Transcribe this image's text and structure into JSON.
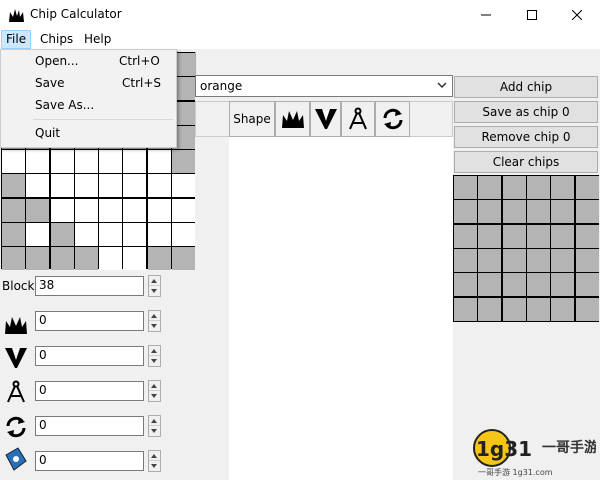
{
  "window": {
    "title": "Chip Calculator"
  },
  "menubar": {
    "items": [
      "File",
      "Chips",
      "Help"
    ]
  },
  "file_menu": {
    "items": [
      {
        "label": "Open...",
        "shortcut": "Ctrl+O"
      },
      {
        "label": "Save",
        "shortcut": "Ctrl+S"
      },
      {
        "label": "Save As...",
        "shortcut": ""
      },
      {
        "label": "Quit",
        "shortcut": ""
      }
    ]
  },
  "board": {
    "rows": [
      [
        "w",
        "w",
        "w",
        "w",
        "w",
        "w",
        "w",
        "g"
      ],
      [
        "g",
        "w",
        "w",
        "w",
        "w",
        "w",
        "w",
        "w"
      ],
      [
        "g",
        "g",
        "w",
        "w",
        "w",
        "w",
        "w",
        "w"
      ],
      [
        "g",
        "w",
        "g",
        "w",
        "w",
        "w",
        "w",
        "w"
      ],
      [
        "g",
        "g",
        "g",
        "g",
        "w",
        "w",
        "g",
        "g"
      ]
    ]
  },
  "stats": {
    "blocks_label": "Blocks",
    "blocks_value": "38",
    "damage_value": "0",
    "breach_value": "0",
    "precision_value": "0",
    "reload_value": "0",
    "extra_value": "0"
  },
  "color_select": {
    "value": "orange"
  },
  "toolbar": {
    "shape_label": "Shape"
  },
  "actions": {
    "add_chip": "Add chip",
    "save_as_chip": "Save as chip 0",
    "remove_chip": "Remove chip 0",
    "clear_chips": "Clear chips"
  },
  "chip_grid": {
    "cols": 6,
    "rows": 6
  },
  "watermark": {
    "brand": "1g31",
    "tag": "一哥手游",
    "url": "一哥手游 1g31.com"
  },
  "colors": {
    "grey_cell": "#b4b4b4",
    "white_cell": "#ffffff",
    "menu_highlight": "#cce8ff"
  }
}
